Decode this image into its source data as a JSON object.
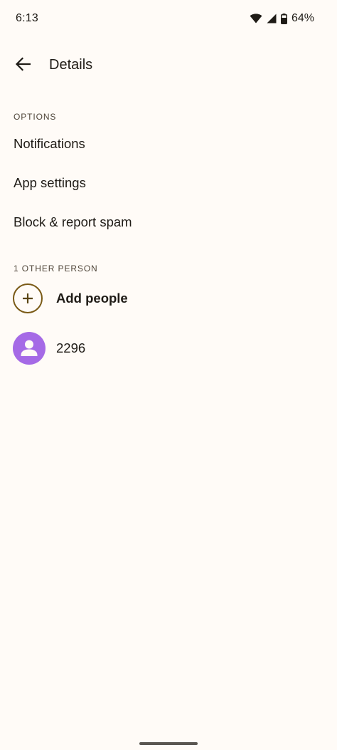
{
  "status_bar": {
    "time": "6:13",
    "battery": "64%",
    "icons": [
      "wifi-icon",
      "signal-icon",
      "battery-icon"
    ]
  },
  "app_bar": {
    "back_icon": "arrow-back-icon",
    "title": "Details"
  },
  "options": {
    "header": "OPTIONS",
    "items": [
      {
        "label": "Notifications"
      },
      {
        "label": "App settings"
      },
      {
        "label": "Block & report spam"
      }
    ]
  },
  "people": {
    "header": "1 OTHER PERSON",
    "add_label": "Add people",
    "add_icon": "add-icon",
    "contacts": [
      {
        "name": "2296",
        "avatar_icon": "person-icon",
        "avatar_color": "#a56ae6"
      }
    ]
  },
  "colors": {
    "background": "#fffbf7",
    "accent": "#7a5a16",
    "avatar": "#a56ae6"
  }
}
